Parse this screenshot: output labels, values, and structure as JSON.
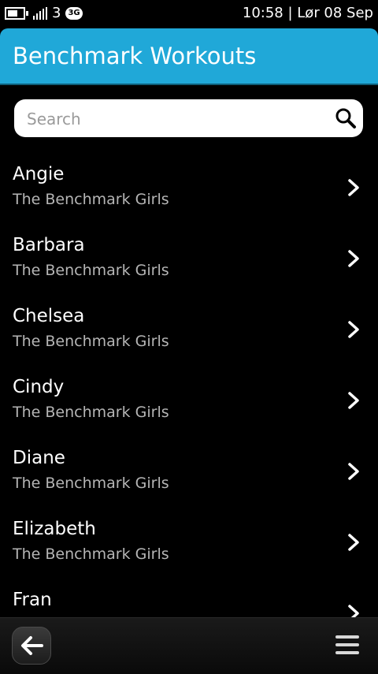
{
  "status_bar": {
    "carrier": "3",
    "network": "3G",
    "datetime": "10:58 | Lør 08 Sep"
  },
  "header": {
    "title": "Benchmark Workouts"
  },
  "search": {
    "placeholder": "Search",
    "value": ""
  },
  "workouts": [
    {
      "name": "Angie",
      "category": "The Benchmark Girls"
    },
    {
      "name": "Barbara",
      "category": "The Benchmark Girls"
    },
    {
      "name": "Chelsea",
      "category": "The Benchmark Girls"
    },
    {
      "name": "Cindy",
      "category": "The Benchmark Girls"
    },
    {
      "name": "Diane",
      "category": "The Benchmark Girls"
    },
    {
      "name": "Elizabeth",
      "category": "The Benchmark Girls"
    },
    {
      "name": "Fran",
      "category": ""
    }
  ],
  "colors": {
    "header": "#20a8d8",
    "background": "#000000"
  },
  "icons": {
    "search": "search-icon",
    "back": "back-arrow-icon",
    "menu": "menu-icon",
    "chevron": "chevron-right-icon"
  }
}
